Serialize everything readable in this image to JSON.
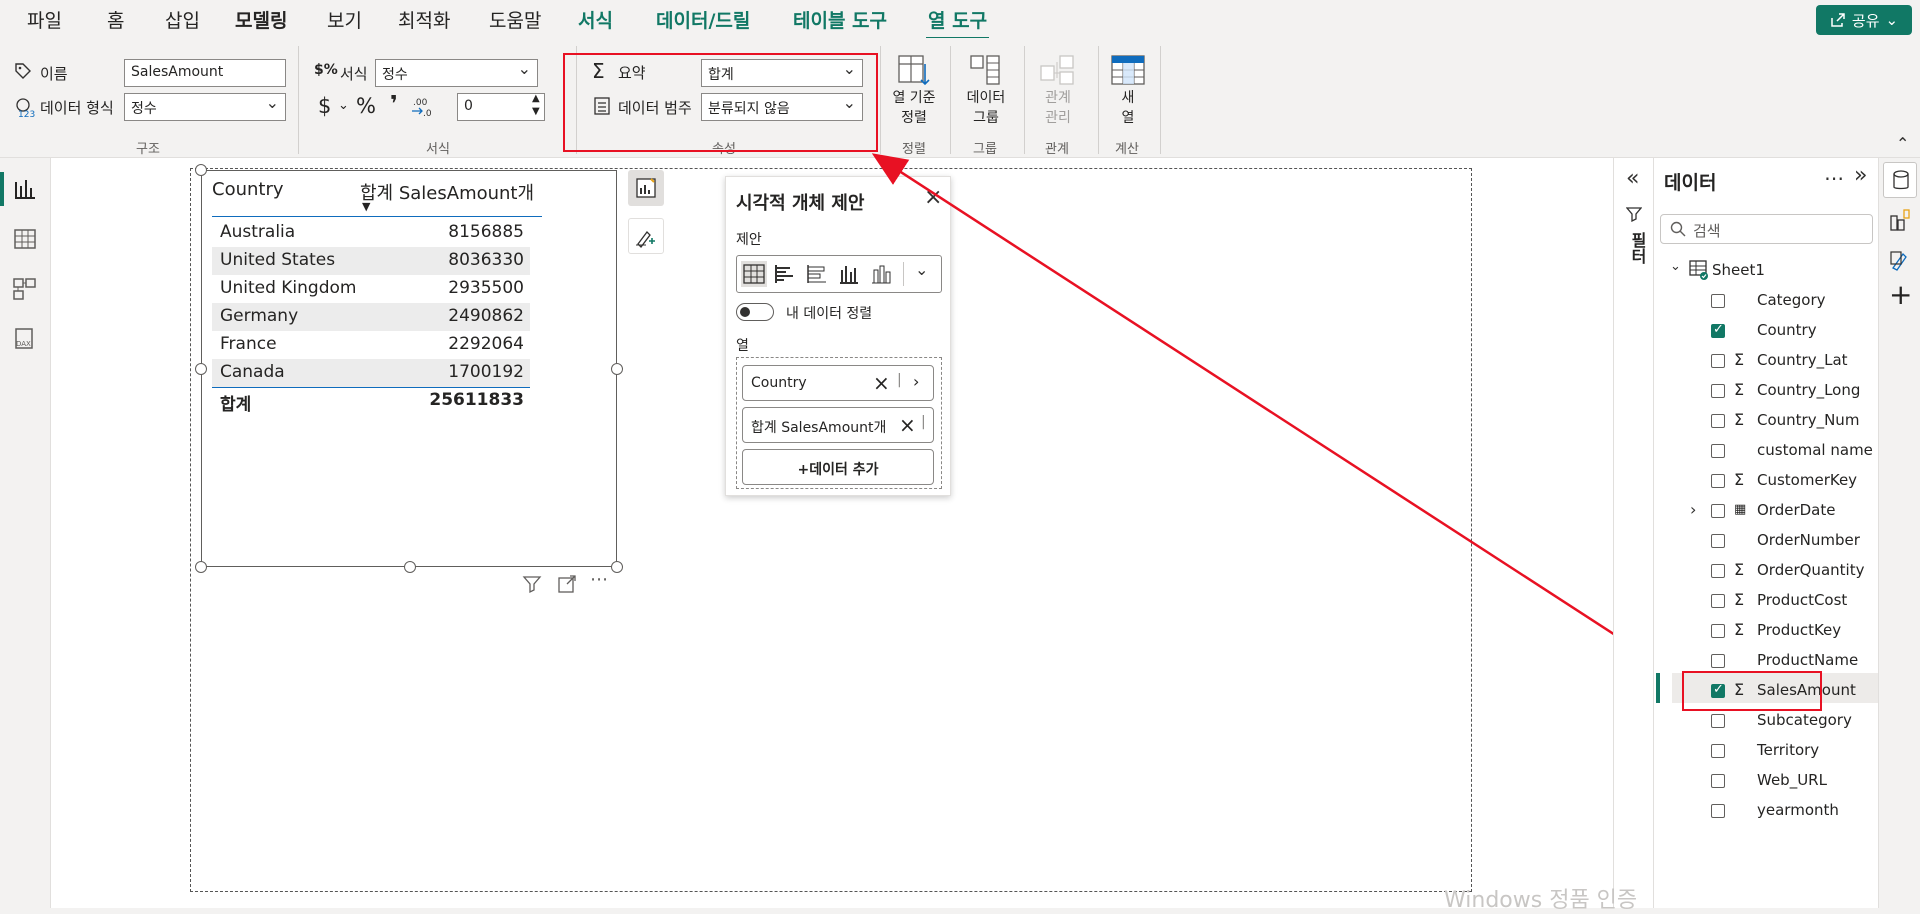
{
  "tabs": [
    "파일",
    "홈",
    "삽입",
    "모델링",
    "보기",
    "최적화",
    "도움말",
    "서식",
    "데이터/드릴",
    "테이블 도구",
    "열 도구"
  ],
  "share_label": "공유",
  "ribbon": {
    "structure": {
      "name_label": "이름",
      "name_value": "SalesAmount",
      "datatype_label": "데이터 형식",
      "datatype_value": "정수",
      "group_label": "구조"
    },
    "format": {
      "format_label": "서식",
      "format_value": "정수",
      "currency_symbol": "$",
      "percent_symbol": "%",
      "comma_symbol": "❜",
      "decimal_value": "0",
      "group_label": "서식"
    },
    "properties": {
      "summary_label": "요약",
      "summary_value": "합계",
      "category_label": "데이터 범주",
      "category_value": "분류되지 않음",
      "group_label": "속성"
    },
    "sort": {
      "line1": "열 기준",
      "line2": "정렬",
      "group_label": "정렬"
    },
    "groups": {
      "line1": "데이터",
      "line2": "그룹",
      "group_label": "그룹"
    },
    "relations": {
      "line1": "관계",
      "line2": "관리",
      "group_label": "관계"
    },
    "calc": {
      "line1": "새",
      "line2": "열",
      "group_label": "계산"
    }
  },
  "table": {
    "col1": "Country",
    "col2": "합계 SalesAmount개",
    "rows": [
      {
        "country": "Australia",
        "value": "8156885"
      },
      {
        "country": "United States",
        "value": "8036330"
      },
      {
        "country": "United Kingdom",
        "value": "2935500"
      },
      {
        "country": "Germany",
        "value": "2490862"
      },
      {
        "country": "France",
        "value": "2292064"
      },
      {
        "country": "Canada",
        "value": "1700192"
      }
    ],
    "total_label": "합계",
    "total_value": "25611833"
  },
  "suggest": {
    "title": "시각적 개체 제안",
    "suggest_label": "제안",
    "toggle_label": "내 데이터 정렬",
    "columns_label": "열",
    "chip1": "Country",
    "chip2": "합계 SalesAmount개",
    "add_label": "+데이터 추가"
  },
  "filters_label": "필터",
  "data_pane": {
    "title": "데이터",
    "search_placeholder": "검색",
    "table_name": "Sheet1",
    "fields": [
      {
        "name": "Category",
        "checked": false,
        "sigma": false
      },
      {
        "name": "Country",
        "checked": true,
        "sigma": false
      },
      {
        "name": "Country_Lat",
        "checked": false,
        "sigma": true
      },
      {
        "name": "Country_Long",
        "checked": false,
        "sigma": true
      },
      {
        "name": "Country_Num",
        "checked": false,
        "sigma": true
      },
      {
        "name": "customal name",
        "checked": false,
        "sigma": false
      },
      {
        "name": "CustomerKey",
        "checked": false,
        "sigma": true
      },
      {
        "name": "OrderDate",
        "checked": false,
        "sigma": false,
        "calendar": true
      },
      {
        "name": "OrderNumber",
        "checked": false,
        "sigma": false
      },
      {
        "name": "OrderQuantity",
        "checked": false,
        "sigma": true
      },
      {
        "name": "ProductCost",
        "checked": false,
        "sigma": true
      },
      {
        "name": "ProductKey",
        "checked": false,
        "sigma": true
      },
      {
        "name": "ProductName",
        "checked": false,
        "sigma": false
      },
      {
        "name": "SalesAmount",
        "checked": true,
        "sigma": true
      },
      {
        "name": "Subcategory",
        "checked": false,
        "sigma": false
      },
      {
        "name": "Territory",
        "checked": false,
        "sigma": false
      },
      {
        "name": "Web_URL",
        "checked": false,
        "sigma": false
      },
      {
        "name": "yearmonth",
        "checked": false,
        "sigma": false
      }
    ]
  },
  "watermark": "Windows 정품 인증",
  "colors": {
    "accent": "#117865",
    "highlight": "#e81123"
  }
}
